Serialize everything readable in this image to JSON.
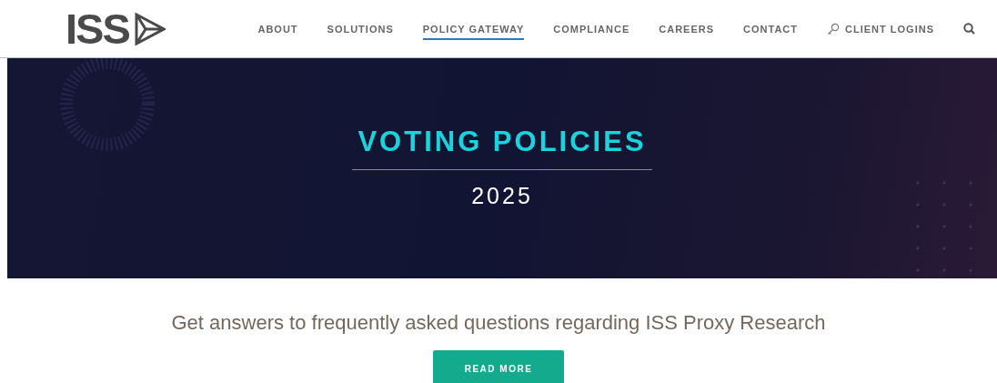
{
  "header": {
    "logo": "ISS",
    "nav": [
      {
        "label": "ABOUT",
        "selected": false
      },
      {
        "label": "SOLUTIONS",
        "selected": false
      },
      {
        "label": "POLICY GATEWAY",
        "selected": true
      },
      {
        "label": "COMPLIANCE",
        "selected": false
      },
      {
        "label": "CAREERS",
        "selected": false
      },
      {
        "label": "CONTACT",
        "selected": false
      },
      {
        "label": "CLIENT LOGINS",
        "selected": false,
        "kind": "login"
      }
    ]
  },
  "hero": {
    "title": "VOTING POLICIES",
    "subtitle": "2025"
  },
  "intro": {
    "text": "Get answers to frequently asked questions regarding ISS Proxy Research",
    "button": "READ MORE"
  }
}
